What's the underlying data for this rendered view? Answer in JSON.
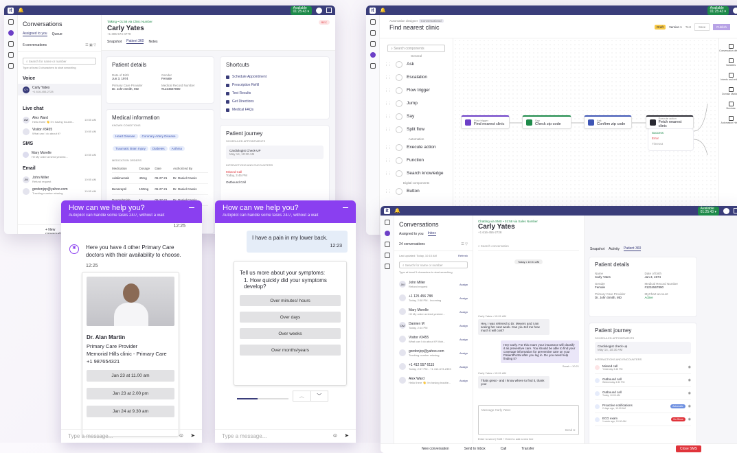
{
  "w1": {
    "nav_title": "Conversations",
    "tabs": [
      "Assigned to you",
      "Queue"
    ],
    "count": "6 conversations",
    "search_placeholder": "Search for name or number",
    "hint": "Type at least 3 characters to start searching",
    "sections": {
      "voice": "Voice",
      "live": "Live chat",
      "sms": "SMS",
      "email": "Email"
    },
    "voice_item": {
      "name": "Carly Yates",
      "sub": "+1 616-455-2728"
    },
    "live_items": [
      {
        "initials": "AW",
        "name": "Alex Ward",
        "sub": "Hello there 👋 I'm having trouble...",
        "time": "10:55 AM"
      },
      {
        "initials": "",
        "name": "Visitor #3455",
        "sub": "What can I do about it?",
        "time": "10:55 AM"
      }
    ],
    "sms_item": {
      "name": "Mary Morelle",
      "sub": "Hi! My order arrived yesterd...",
      "time": "10:55 AM"
    },
    "email_items": [
      {
        "initials": "JM",
        "name": "John Miller",
        "sub": "Refund request",
        "time": "10:55 AM"
      },
      {
        "initials": "",
        "name": "gordonjcp@yahoo.com",
        "sub": "Tracking number missing",
        "time": "10:55 AM"
      }
    ],
    "new_conv": "+ New conversation",
    "call_status": "Talking • 01:58 via Clinic Number",
    "caller": "Carly Yates",
    "caller_phone": "+1 305-574-4779",
    "rec": "REC",
    "detail_tabs": [
      "Snapshot",
      "Patient 360",
      "Notes"
    ],
    "patient_title": "Patient details",
    "dob_label": "Date of Birth",
    "dob": "Jun 3, 1974",
    "gender_label": "Gender",
    "gender": "Female",
    "pcp_label": "Primary Care Provider",
    "pcp": "Dr. John Smith, MD",
    "mrn_label": "Medical Record Number",
    "mrn": "#1234567890",
    "med_title": "Medical information",
    "known": "KNOWN CONDITIONS",
    "conditions": [
      "Heart Disease",
      "Coronary Artery Disease",
      "Traumatic Brain Injury",
      "Diabetes",
      "Asthma"
    ],
    "orders": "MEDICATION ORDERS",
    "med_cols": [
      "Medication",
      "Dosage",
      "Date",
      "Authorized By"
    ],
    "med_rows": [
      [
        "Adalimumab",
        "40mg",
        "05-27-21",
        "Dr. Daniel Cassis"
      ],
      [
        "Benazepril",
        "100mg",
        "05-27-21",
        "Dr. Daniel Cassis"
      ],
      [
        "Doxorubmide",
        "1g",
        "05-27-21",
        "Dr. Daniel Cassis"
      ]
    ],
    "shortcuts_title": "Shortcuts",
    "shortcuts": [
      "Schedule Appointment",
      "Prescription Refill",
      "Test Results",
      "Get Directions",
      "Medical FAQs"
    ],
    "journey_title": "Patient journey",
    "scheduled": "SCHEDULED APPOINTMENTS",
    "appt": "Cardiologist Check-UP",
    "appt_time": "May 14, 10:30 AM",
    "interactions": "INTERACTIONS AND ENCOUNTERS",
    "missed": "Missed Call",
    "missed_time": "Today, 3:45 PM",
    "outbound": "Outbound Call"
  },
  "chat1": {
    "title": "How can we help you?",
    "subtitle": "Autopilot can handle some tasks 24/7, without a wait",
    "time_top": "12:25",
    "bot_msg": "Here you have 4 other Primary Care doctors with their availability to choose.",
    "bot_time": "12:25",
    "doctor_name": "Dr. Alan Martin",
    "doctor_role": "Primary Care Provider",
    "doctor_clinic": "Memorial Hills clinic - Primary Care",
    "doctor_phone": "+1 987654321",
    "slots": [
      "Jan 23 at 11.00 am",
      "Jan 23 at 2.00 pm",
      "Jan 24 at 9.30 am"
    ],
    "placeholder": "Type a message..."
  },
  "chat2": {
    "title": "How can we help you?",
    "subtitle": "Autopilot can handle some tasks 24/7, without a wait",
    "user_msg": "I have a pain in my lower back.",
    "user_time": "12:23",
    "q_title": "Tell us more about your symptoms:",
    "q_item": "1. How quickly did your symptoms develop?",
    "choices": [
      "Over minutes/ hours",
      "Over days",
      "Over weeks",
      "Over months/years"
    ],
    "placeholder": "Type a message..."
  },
  "w2": {
    "crumb": "Automation designer",
    "tag": "Conversational",
    "title": "Find nearest clinic",
    "draft": "Draft",
    "version": "Version 1",
    "test": "Test",
    "save": "Save",
    "publish": "Publish",
    "search_placeholder": "Search components",
    "group1": "General",
    "comps1": [
      "Ask",
      "Escalation",
      "Flow trigger",
      "Jump",
      "Say",
      "Split flow"
    ],
    "group2": "Automation",
    "comps2": [
      "Execute action",
      "Function",
      "Search knowledge"
    ],
    "group3": "Digital components",
    "comps3": [
      "Button"
    ],
    "nodes": [
      {
        "tag": "Flow trigger",
        "label": "Find nearest clinic"
      },
      {
        "tag": "Say",
        "label": "Check zip code"
      },
      {
        "tag": "Ask",
        "label": "Confirm zip code"
      },
      {
        "tag": "Execute action",
        "label": "Fetch nearest clinic"
      }
    ],
    "outcomes": [
      "Success",
      "Error",
      "Timeout"
    ],
    "right_tools": [
      "Conversation defaults",
      "Variables",
      "Intents and entities",
      "Domain Markers",
      "Simulate",
      "Automation Helper"
    ]
  },
  "w3": {
    "title": "Conversations",
    "tabs": [
      "Assigned to you",
      "Inbox"
    ],
    "count": "24 conversations",
    "last_updated": "Last updated: Today, 10:15 AM",
    "refresh": "Refresh",
    "search_placeholder": "Search for name or number",
    "hint": "Type at least 3 characters to start searching",
    "items": [
      {
        "initials": "JM",
        "name": "John Miller",
        "sub": "Refund request"
      },
      {
        "initials": "",
        "name": "+1 125 456 788",
        "sub": "Today, 2:58 PM - Incoming"
      },
      {
        "initials": "",
        "name": "Mary Morelle",
        "sub": "Hi! My order arrived yesterd..."
      },
      {
        "initials": "DM",
        "name": "Damien M",
        "sub": "Today, 2:44 PM"
      },
      {
        "initials": "",
        "name": "Visitor #3455",
        "sub": "What can I do about it? Mob..."
      },
      {
        "initials": "",
        "name": "gordonjcp@yahoo.com",
        "sub": "Tracking number missing"
      },
      {
        "initials": "",
        "name": "+1 412 557 6115",
        "sub": "Today, 2:57 PM - +1 412-673-2393"
      },
      {
        "initials": "",
        "name": "Alex Ward",
        "sub": "Hello there 👋 I'm having trouble..."
      }
    ],
    "assign": "Assign",
    "chat_status": "Chatting via SMS • 01:58 via Sales Number",
    "chat_name": "Carly Yates",
    "chat_phone": "+1 616-455-2728",
    "search_conv": "Search conversation",
    "date_chip": "Today • 10:01 AM",
    "m1_head": "Carly Yates • 10:01 AM",
    "m1": "Hey, I was referred to Dr. Meyers and I am seeing her next week. Can you tell me how much it will cost?",
    "m2": "Hey Carly. For this exam your insurance will classify it as preventive care. You should be able to find your coverage information for preventive care on your PatientPortal after you log in. Do you need help finding it?",
    "m2_foot": "Sarah • 10:21",
    "m3_head": "Carly Yates • 10:01 AM",
    "m3": "Thats great - and I know where to find it, thank you!",
    "compose": "Message Carly Yates",
    "send": "Send",
    "send_hint": "Enter to send | Shift + Enter to add a new line",
    "right_tabs": [
      "Snapshot",
      "Activity",
      "Patient 360"
    ],
    "pd_title": "Patient details",
    "name_label": "Name",
    "name": "Carly Yates",
    "dob_label": "Date of birth",
    "dob": "Jun 3, 1974",
    "gender_label": "Gender",
    "gender": "Female",
    "mrn_label": "Medical Record Number",
    "mrn": "#1234567890",
    "pcp_label": "Primary Care Provider",
    "pcp": "Dr. John Smith, MD",
    "mychart_label": "MyChart account",
    "mychart": "Active",
    "journey_title": "Patient journey",
    "scheduled": "SCHEDULED APPOINTMENTS",
    "appt": "Cardiologist check-up",
    "appt_time": "May 14, 10:30 AM",
    "interactions": "INTERACTIONS AND ENCOUNTERS",
    "events": [
      {
        "name": "Missed call",
        "sub": "Yesterday 3:45 PM",
        "badge": ""
      },
      {
        "name": "Outbound call",
        "sub": "Wednesday 4:32 PM",
        "badge": ""
      },
      {
        "name": "Outbound call",
        "sub": "Today, 10:00 AM",
        "badge": ""
      },
      {
        "name": "Proactive notifications",
        "sub": "2 days ago, 10:00 AM",
        "badge": "Automatic"
      },
      {
        "name": "ECG exam",
        "sub": "1 week ago, 10:00 AM",
        "badge": "No Show"
      }
    ],
    "footer": [
      "New conversation",
      "Send to Inbox",
      "Call",
      "Transfer"
    ],
    "close": "Close SMS"
  },
  "colors": {
    "purple": "#8a3ff0",
    "navy": "#3a3d7a",
    "green": "#1e8a4a",
    "red": "#e0343b"
  }
}
